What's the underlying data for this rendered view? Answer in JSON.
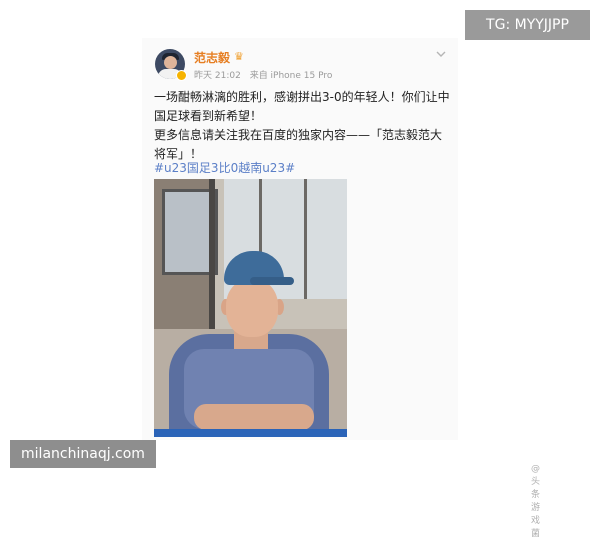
{
  "overlays": {
    "telegram": "TG: MYYJJPP",
    "site": "milanchinaqj.com"
  },
  "post": {
    "username": "范志毅",
    "crown": "♛",
    "time": "昨天 21:02",
    "source": "来自 iPhone 15 Pro",
    "lines": [
      "一场酣畅淋漓的胜利，感谢拼出3-0的年轻人！你们让中",
      "国足球看到新希望！",
      "更多信息请关注我在百度的独家内容——「范志毅范大",
      "将军」！"
    ],
    "hashtags": "#u23国足3比0越南u23#",
    "watermark": "@头条游戏菌",
    "photo_mini_label": "@"
  },
  "colors": {
    "username": "#e67e22",
    "hashtag": "#5b7fc7",
    "meta": "#9a9a9a"
  }
}
